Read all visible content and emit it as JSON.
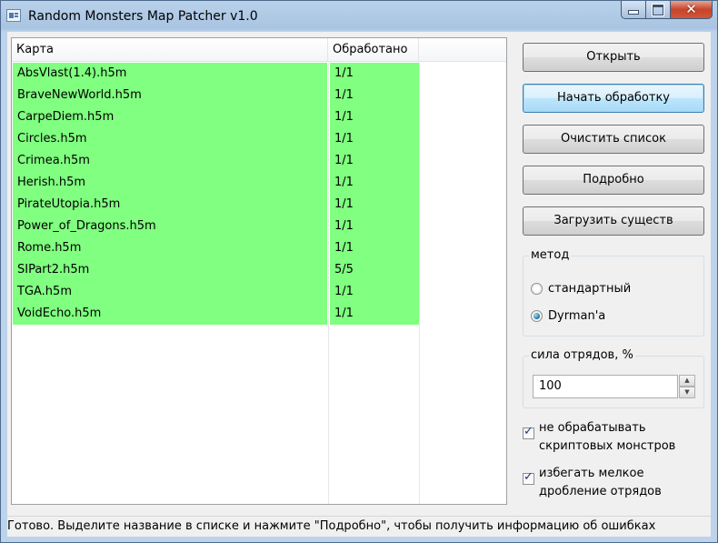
{
  "window": {
    "title": "Random Monsters Map Patcher v1.0"
  },
  "list": {
    "columns": [
      "Карта",
      "Обработано"
    ],
    "row_color": "#80ff80",
    "rows": [
      {
        "map": "AbsVlast(1.4).h5m",
        "processed": "1/1"
      },
      {
        "map": "BraveNewWorld.h5m",
        "processed": "1/1"
      },
      {
        "map": "CarpeDiem.h5m",
        "processed": "1/1"
      },
      {
        "map": "Circles.h5m",
        "processed": "1/1"
      },
      {
        "map": "Crimea.h5m",
        "processed": "1/1"
      },
      {
        "map": "Herish.h5m",
        "processed": "1/1"
      },
      {
        "map": "PirateUtopia.h5m",
        "processed": "1/1"
      },
      {
        "map": "Power_of_Dragons.h5m",
        "processed": "1/1"
      },
      {
        "map": "Rome.h5m",
        "processed": "1/1"
      },
      {
        "map": "SIPart2.h5m",
        "processed": "5/5"
      },
      {
        "map": "TGA.h5m",
        "processed": "1/1"
      },
      {
        "map": "VoidEcho.h5m",
        "processed": "1/1"
      }
    ]
  },
  "buttons": {
    "open": "Открыть",
    "start": "Начать обработку",
    "clear": "Очистить список",
    "details": "Подробно",
    "load_creatures": "Загрузить существ"
  },
  "method": {
    "title": "метод",
    "options": [
      "стандартный",
      "Dyrman'a"
    ],
    "selected": "Dyrman'a"
  },
  "strength": {
    "title": "сила отрядов, %",
    "value": "100"
  },
  "checkboxes": {
    "skip_scripted": {
      "line1": "не обрабатывать",
      "line2": "скриптовых монстров",
      "checked": true
    },
    "avoid_split": {
      "line1": "избегать мелкое",
      "line2": "дробление отрядов",
      "checked": true
    }
  },
  "status": "Готово. Выделите название в списке и нажмите \"Подробно\", чтобы получить информацию об ошибках"
}
